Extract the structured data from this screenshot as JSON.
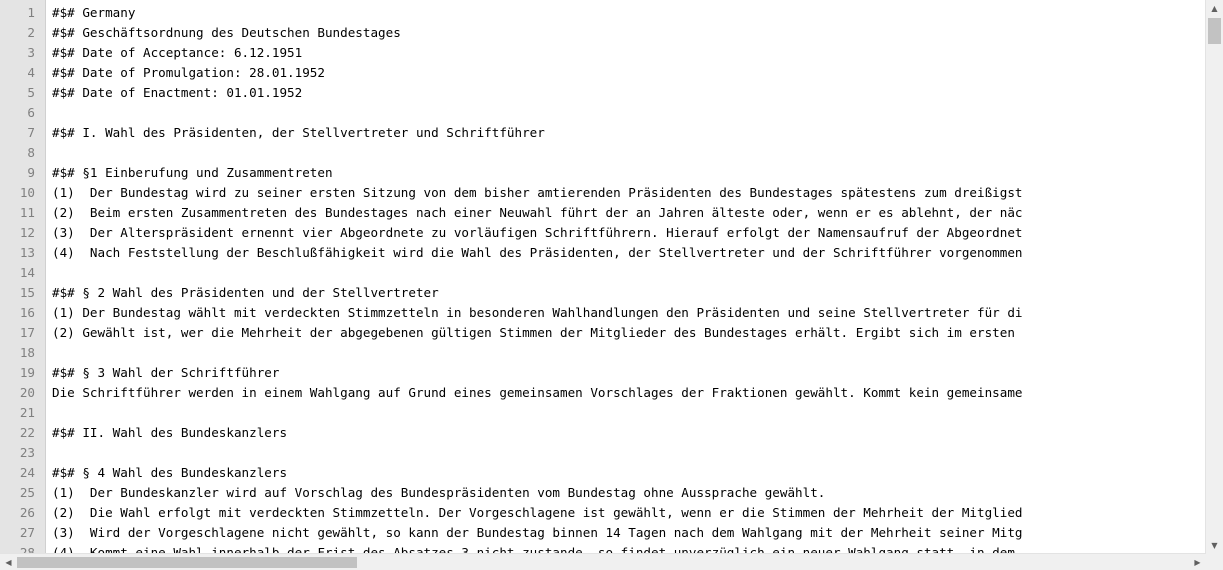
{
  "editor": {
    "lines": [
      {
        "num": "1",
        "text": "#$# Germany"
      },
      {
        "num": "2",
        "text": "#$# Geschäftsordnung des Deutschen Bundestages"
      },
      {
        "num": "3",
        "text": "#$# Date of Acceptance: 6.12.1951"
      },
      {
        "num": "4",
        "text": "#$# Date of Promulgation: 28.01.1952"
      },
      {
        "num": "5",
        "text": "#$# Date of Enactment: 01.01.1952"
      },
      {
        "num": "6",
        "text": ""
      },
      {
        "num": "7",
        "text": "#$# I. Wahl des Präsidenten, der Stellvertreter und Schriftführer"
      },
      {
        "num": "8",
        "text": ""
      },
      {
        "num": "9",
        "text": "#$# §1 Einberufung und Zusammentreten"
      },
      {
        "num": "10",
        "text": "(1)  Der Bundestag wird zu seiner ersten Sitzung von dem bisher amtierenden Präsidenten des Bundestages spätestens zum dreißigst"
      },
      {
        "num": "11",
        "text": "(2)  Beim ersten Zusammentreten des Bundestages nach einer Neuwahl führt der an Jahren älteste oder, wenn er es ablehnt, der näc"
      },
      {
        "num": "12",
        "text": "(3)  Der Alterspräsident ernennt vier Abgeordnete zu vorläufigen Schriftführern. Hierauf erfolgt der Namensaufruf der Abgeordnet"
      },
      {
        "num": "13",
        "text": "(4)  Nach Feststellung der Beschlußfähigkeit wird die Wahl des Präsidenten, der Stellvertreter und der Schriftführer vorgenommen"
      },
      {
        "num": "14",
        "text": ""
      },
      {
        "num": "15",
        "text": "#$# § 2 Wahl des Präsidenten und der Stellvertreter"
      },
      {
        "num": "16",
        "text": "(1) Der Bundestag wählt mit verdeckten Stimmzetteln in besonderen Wahlhandlungen den Präsidenten und seine Stellvertreter für di"
      },
      {
        "num": "17",
        "text": "(2) Gewählt ist, wer die Mehrheit der abgegebenen gültigen Stimmen der Mitglieder des Bundestages erhält. Ergibt sich im ersten"
      },
      {
        "num": "18",
        "text": ""
      },
      {
        "num": "19",
        "text": "#$# § 3 Wahl der Schriftführer"
      },
      {
        "num": "20",
        "text": "Die Schriftführer werden in einem Wahlgang auf Grund eines gemeinsamen Vorschlages der Fraktionen gewählt. Kommt kein gemeinsame"
      },
      {
        "num": "21",
        "text": ""
      },
      {
        "num": "22",
        "text": "#$# II. Wahl des Bundeskanzlers"
      },
      {
        "num": "23",
        "text": ""
      },
      {
        "num": "24",
        "text": "#$# § 4 Wahl des Bundeskanzlers"
      },
      {
        "num": "25",
        "text": "(1)  Der Bundeskanzler wird auf Vorschlag des Bundespräsidenten vom Bundestag ohne Aussprache gewählt."
      },
      {
        "num": "26",
        "text": "(2)  Die Wahl erfolgt mit verdeckten Stimmzetteln. Der Vorgeschlagene ist gewählt, wenn er die Stimmen der Mehrheit der Mitglied"
      },
      {
        "num": "27",
        "text": "(3)  Wird der Vorgeschlagene nicht gewählt, so kann der Bundestag binnen 14 Tagen nach dem Wahlgang mit der Mehrheit seiner Mitg"
      },
      {
        "num": "28",
        "text": "(4)  Kommt eine Wahl innerhalb der Frist des Absatzes 3 nicht zustande, so findet unverzüglich ein neuer Wahlgang statt, in dem"
      }
    ]
  },
  "scrollbar": {
    "up_icon": "▲",
    "down_icon": "▼",
    "left_icon": "◀",
    "right_icon": "▶"
  }
}
